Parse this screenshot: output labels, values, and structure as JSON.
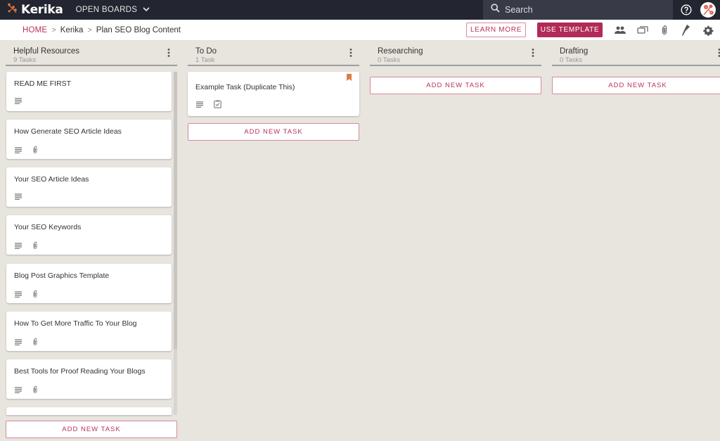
{
  "topbar": {
    "app_name": "Kerika",
    "open_boards_label": "OPEN BOARDS",
    "search_placeholder": "Search"
  },
  "breadcrumb": {
    "home": "HOME",
    "items": [
      "Kerika",
      "Plan SEO Blog Content"
    ]
  },
  "toolbar": {
    "learn_more_label": "LEARN MORE",
    "use_template_label": "USE TEMPLATE",
    "icons": [
      "team-icon",
      "chat-icon",
      "attachment-icon",
      "highlight-icon",
      "settings-icon"
    ]
  },
  "colors": {
    "accent": "#b22a57",
    "topbar": "#232530",
    "board_bg": "#e8e4de",
    "bookmark": "#e07b4a"
  },
  "columns": [
    {
      "title": "Helpful Resources",
      "count": "9 Tasks",
      "cards": [
        {
          "title": "READ ME FIRST",
          "icons": [
            "description"
          ]
        },
        {
          "title": "How Generate SEO Article Ideas",
          "icons": [
            "description",
            "attachment"
          ]
        },
        {
          "title": "Your SEO Article Ideas",
          "icons": [
            "description"
          ]
        },
        {
          "title": "Your SEO Keywords",
          "icons": [
            "description",
            "attachment"
          ]
        },
        {
          "title": "Blog Post Graphics Template",
          "icons": [
            "description",
            "attachment"
          ]
        },
        {
          "title": "How To Get More Traffic To Your Blog",
          "icons": [
            "description",
            "attachment"
          ]
        },
        {
          "title": "Best Tools for Proof Reading Your Blogs",
          "icons": [
            "description",
            "attachment"
          ]
        }
      ],
      "add_label": "ADD NEW TASK"
    },
    {
      "title": "To Do",
      "count": "1 Task",
      "cards": [
        {
          "title": "Example Task (Duplicate This)",
          "icons": [
            "description",
            "checklist"
          ],
          "bookmarked": true
        }
      ],
      "add_label": "ADD NEW TASK"
    },
    {
      "title": "Researching",
      "count": "0 Tasks",
      "cards": [],
      "add_label": "ADD NEW TASK"
    },
    {
      "title": "Drafting",
      "count": "0 Tasks",
      "cards": [],
      "add_label": "ADD NEW TASK"
    }
  ]
}
